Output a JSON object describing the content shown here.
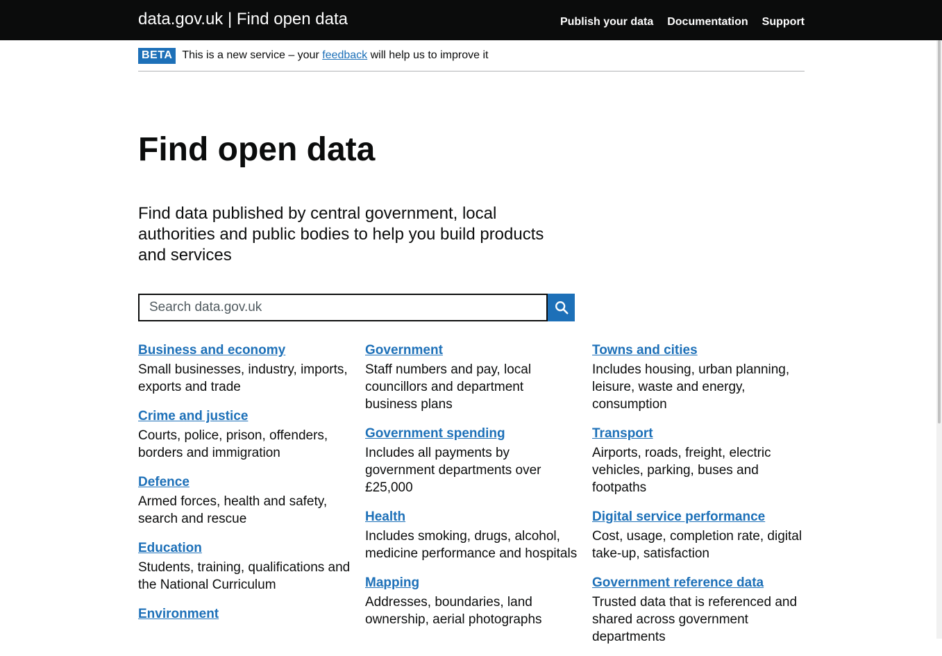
{
  "header": {
    "title": "data.gov.uk | Find open data",
    "nav": [
      "Publish your data",
      "Documentation",
      "Support"
    ]
  },
  "phase_banner": {
    "tag": "BETA",
    "text_before": "This is a new service – your ",
    "link": "feedback",
    "text_after": " will help us to improve it"
  },
  "page_title": "Find open data",
  "lead": "Find data published by central government, local authorities and public bodies to help you build products and services",
  "search": {
    "placeholder": "Search data.gov.uk",
    "icon": "search-icon"
  },
  "topics": {
    "col1": [
      {
        "title": "Business and economy",
        "desc": "Small businesses, industry, imports, exports and trade"
      },
      {
        "title": "Crime and justice",
        "desc": "Courts, police, prison, offenders, borders and immigration"
      },
      {
        "title": "Defence",
        "desc": "Armed forces, health and safety, search and rescue"
      },
      {
        "title": "Education",
        "desc": "Students, training, qualifications and the National Curriculum"
      },
      {
        "title": "Environment",
        "desc": ""
      }
    ],
    "col2": [
      {
        "title": "Government",
        "desc": "Staff numbers and pay, local councillors and department business plans"
      },
      {
        "title": "Government spending",
        "desc": "Includes all payments by government departments over £25,000"
      },
      {
        "title": "Health",
        "desc": "Includes smoking, drugs, alcohol, medicine performance and hospitals"
      },
      {
        "title": "Mapping",
        "desc": "Addresses, boundaries, land ownership, aerial photographs"
      }
    ],
    "col3": [
      {
        "title": "Towns and cities",
        "desc": "Includes housing, urban planning, leisure, waste and energy, consumption"
      },
      {
        "title": "Transport",
        "desc": "Airports, roads, freight, electric vehicles, parking, buses and footpaths"
      },
      {
        "title": "Digital service performance",
        "desc": "Cost, usage, completion rate, digital take-up, satisfaction"
      },
      {
        "title": "Government reference data",
        "desc": "Trusted data that is referenced and shared across government departments"
      }
    ]
  },
  "colors": {
    "header_bg": "#0b0c0c",
    "link": "#1d70b8",
    "text": "#0b0c0c",
    "tag_bg": "#1d70b8"
  }
}
